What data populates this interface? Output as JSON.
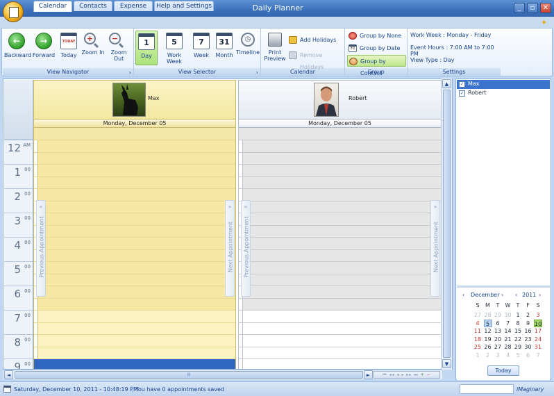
{
  "window": {
    "title": "Daily Planner",
    "min": "_",
    "max": "▫",
    "close": "✕"
  },
  "tabs": [
    {
      "label": "Calendar"
    },
    {
      "label": "Contacts"
    },
    {
      "label": "Expense"
    },
    {
      "label": "Help and Settings"
    }
  ],
  "ribbon": {
    "view_navigator": {
      "label": "View Navigator",
      "expander": "›",
      "buttons": [
        {
          "label": "Backward",
          "icon": "←"
        },
        {
          "label": "Forward",
          "icon": "→"
        },
        {
          "label": "Today",
          "icon": "TODAY"
        },
        {
          "label": "Zoom In",
          "icon": "+"
        },
        {
          "label": "Zoom Out",
          "icon": "−"
        }
      ]
    },
    "view_selector": {
      "label": "View Selector",
      "expander": "›",
      "buttons": [
        {
          "label": "Day",
          "icon": "1"
        },
        {
          "label": "Work Week",
          "icon": "5"
        },
        {
          "label": "Week",
          "icon": "7"
        },
        {
          "label": "Month",
          "icon": "31"
        },
        {
          "label": "Timeline",
          "icon": "◷"
        }
      ]
    },
    "calendar": {
      "label": "Calendar",
      "print_preview_l1": "Print",
      "print_preview_l2": "Preview",
      "add_holidays": "Add Holidays",
      "remove_holidays": "Remove Holidays"
    },
    "group": {
      "label": "Group",
      "by_none": "Group by None",
      "by_date": "Group by Date",
      "by_contact": "Group by Contact",
      "date_icon": "31"
    },
    "settings": {
      "label": "Settings",
      "work_week": "Work Week : Monday - Friday",
      "event_hours": "Event Hours : 7:00 AM to 7:00 PM",
      "view_type": "View Type : Day"
    }
  },
  "scheduler": {
    "resources": [
      {
        "name": "Max",
        "date": "Monday, December 05"
      },
      {
        "name": "Robert",
        "date": "Monday, December 05"
      }
    ],
    "hours": [
      {
        "h": "12",
        "m": "AM"
      },
      {
        "h": "1",
        "m": "00"
      },
      {
        "h": "2",
        "m": "00"
      },
      {
        "h": "3",
        "m": "00"
      },
      {
        "h": "4",
        "m": "00"
      },
      {
        "h": "5",
        "m": "00"
      },
      {
        "h": "6",
        "m": "00"
      },
      {
        "h": "7",
        "m": "00"
      },
      {
        "h": "8",
        "m": "00"
      },
      {
        "h": "9",
        "m": "00"
      }
    ],
    "prev_appointment": "Previous Appointment",
    "next_appointment": "Next Appointment",
    "prev_arrow": "«",
    "next_arrow": "»"
  },
  "scroll": {
    "up": "▲",
    "down": "▼",
    "left": "◄",
    "right": "►",
    "thumb": "III"
  },
  "right_panel": {
    "resources": [
      {
        "name": "Max",
        "checked": "✓"
      },
      {
        "name": "Robert",
        "checked": "✓"
      }
    ],
    "calendar": {
      "month": "December",
      "year": "2011",
      "prev": "‹",
      "next": "›",
      "weekdays": [
        "S",
        "M",
        "T",
        "W",
        "T",
        "F",
        "S"
      ],
      "weeks": [
        [
          "27",
          "28",
          "29",
          "30",
          "1",
          "2",
          "3"
        ],
        [
          "4",
          "5",
          "6",
          "7",
          "8",
          "9",
          "10"
        ],
        [
          "11",
          "12",
          "13",
          "14",
          "15",
          "16",
          "17"
        ],
        [
          "18",
          "19",
          "20",
          "21",
          "22",
          "23",
          "24"
        ],
        [
          "25",
          "26",
          "27",
          "28",
          "29",
          "30",
          "31"
        ],
        [
          "1",
          "2",
          "3",
          "4",
          "5",
          "6",
          "7"
        ]
      ],
      "today_label": "Today"
    }
  },
  "status": {
    "datetime": "Saturday, December 10, 2011 - 10:48:19 PM",
    "message": "You have 0 appointments saved",
    "brand": "iMaginary"
  }
}
